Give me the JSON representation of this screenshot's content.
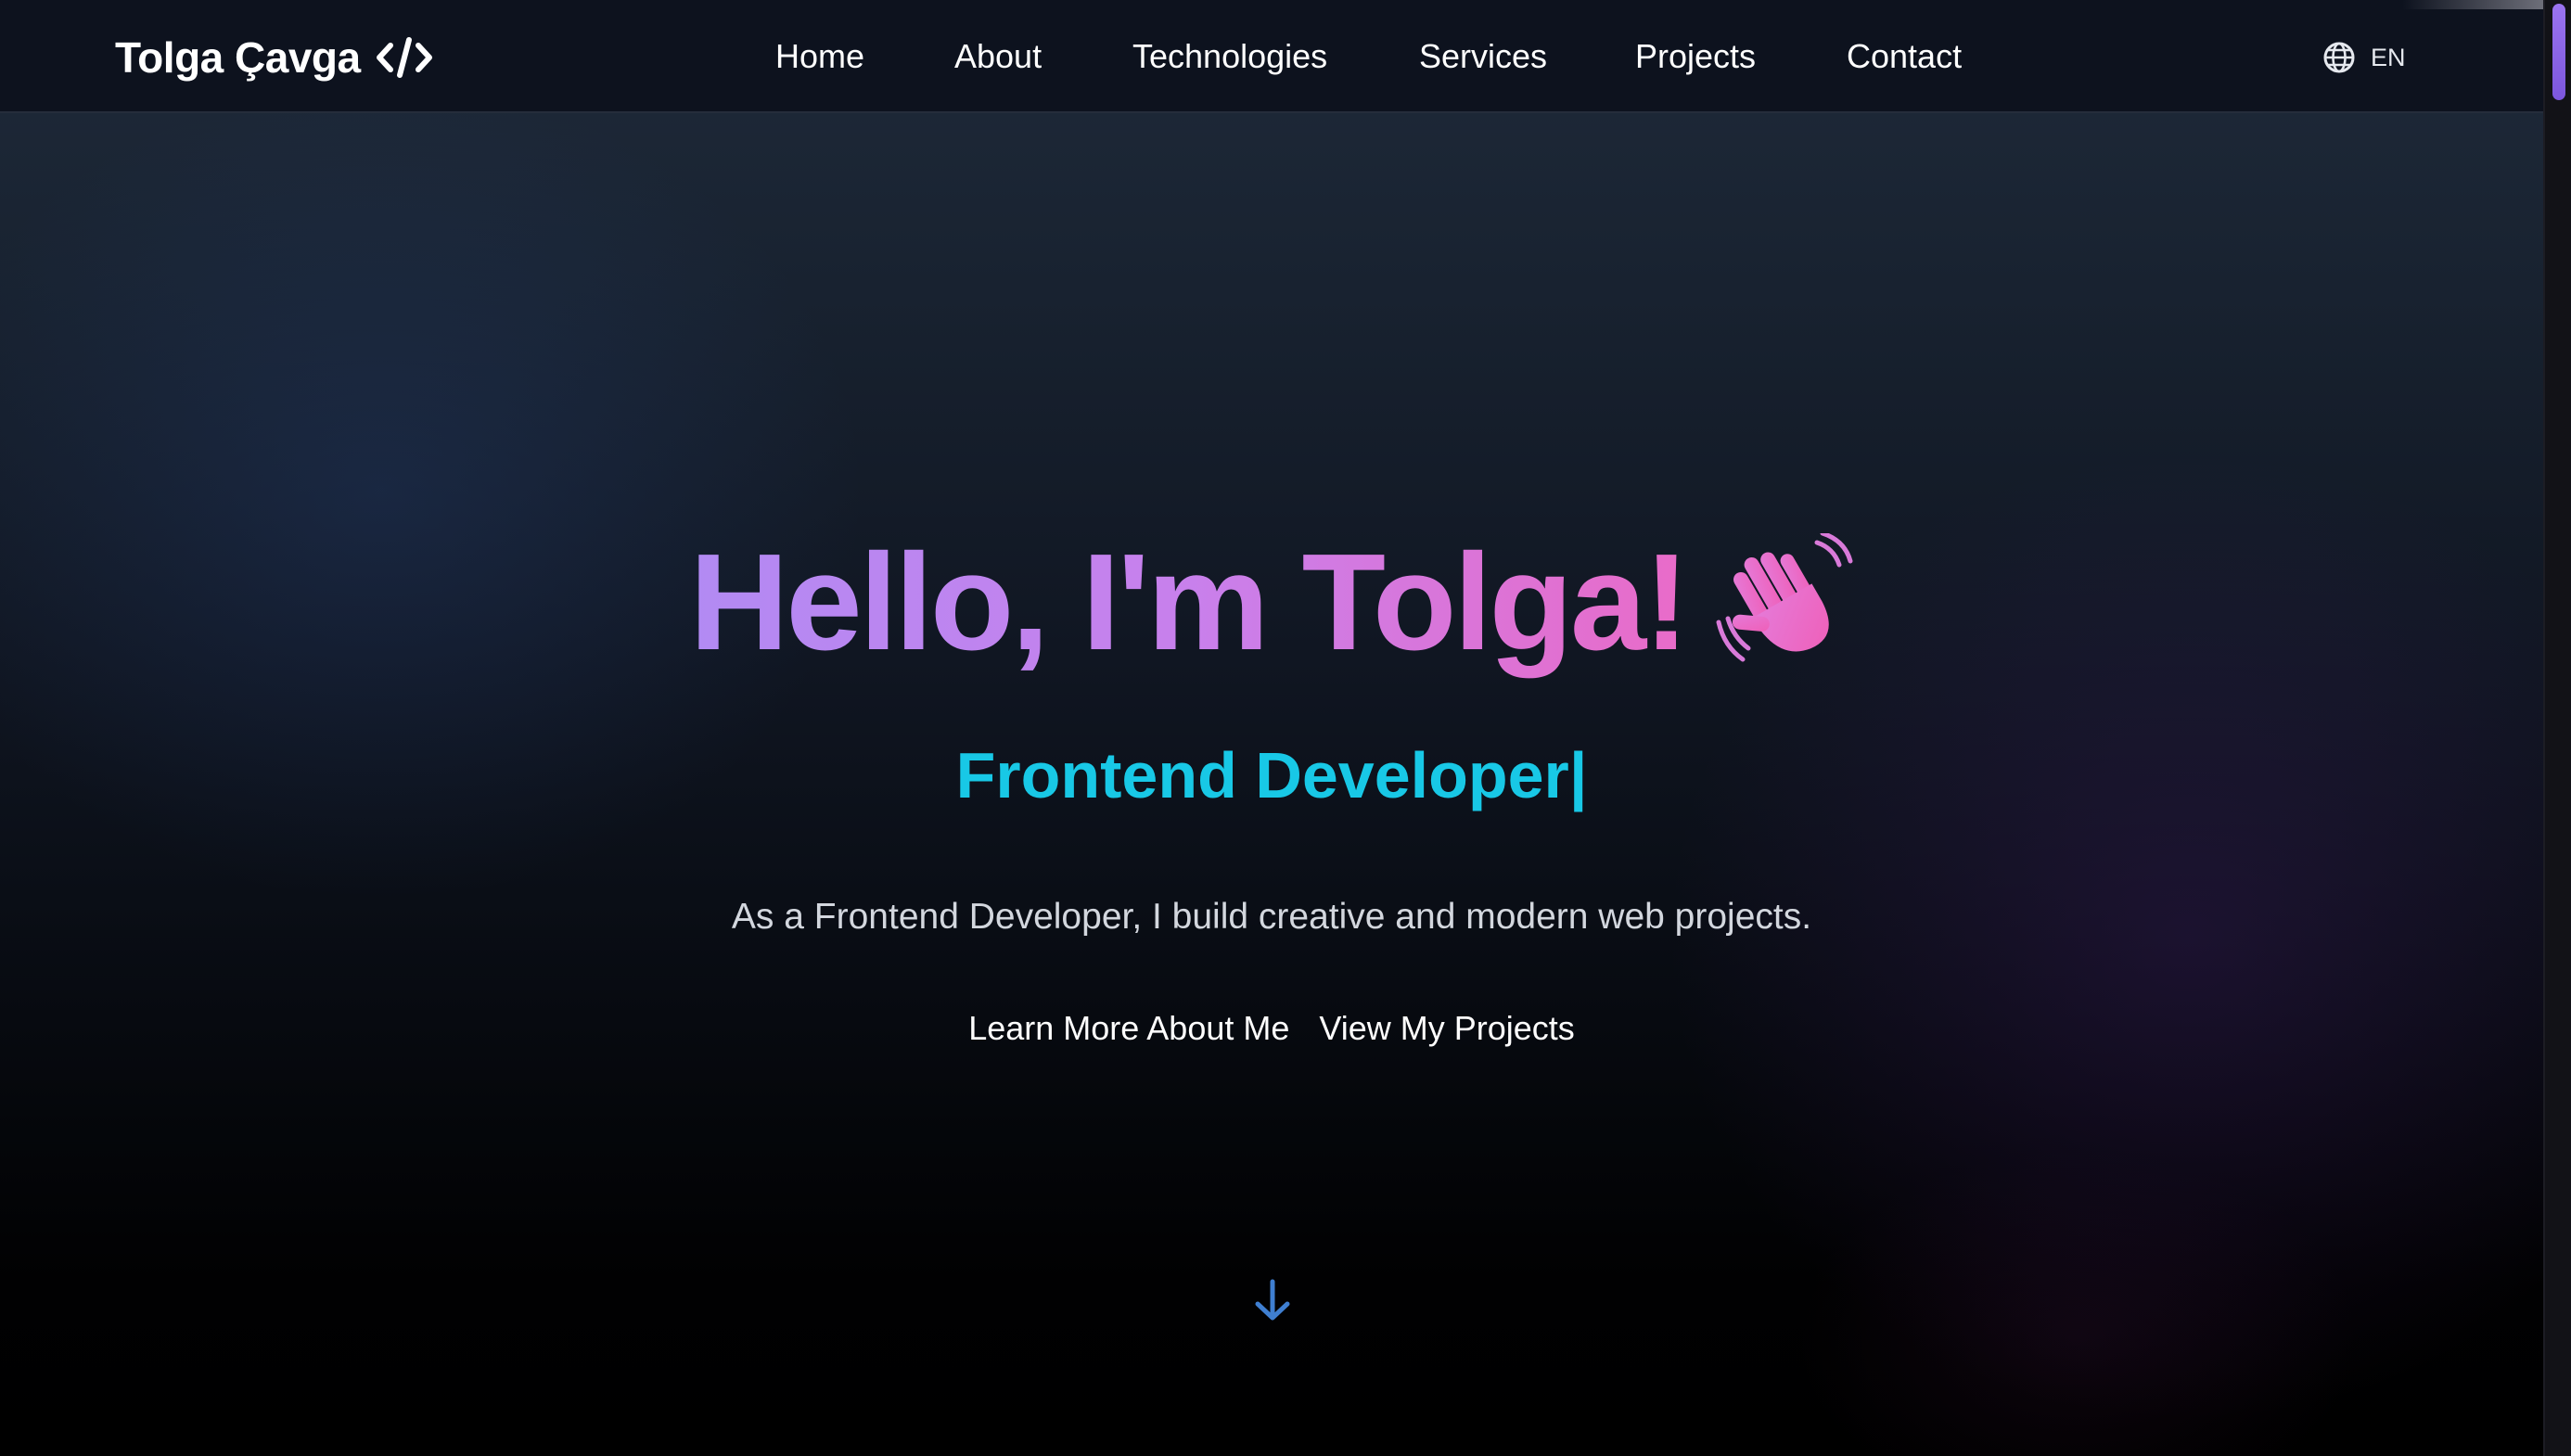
{
  "navbar": {
    "brand": "Tolga Çavga",
    "brand_icon": "code-brackets-icon",
    "links": [
      {
        "label": "Home"
      },
      {
        "label": "About"
      },
      {
        "label": "Technologies"
      },
      {
        "label": "Services"
      },
      {
        "label": "Projects"
      },
      {
        "label": "Contact"
      }
    ],
    "language": {
      "icon": "globe-icon",
      "label": "EN"
    }
  },
  "hero": {
    "title": "Hello, I'm Tolga!",
    "title_icon": "waving-hand-icon",
    "role": "Frontend Developer",
    "cursor": "|",
    "description": "As a Frontend Developer, I build creative and modern web projects.",
    "cta_primary": "Learn More About Me",
    "cta_secondary": "View My Projects",
    "scroll_icon": "arrow-down-icon"
  },
  "colors": {
    "title_gradient_start": "#b28af3",
    "title_gradient_end": "#e96bc8",
    "role": "#18c8e6",
    "scroll_arrow": "#3f7fd1",
    "scroll_thumb": "#8b64e8",
    "navbar_bg": "#0d121e"
  }
}
